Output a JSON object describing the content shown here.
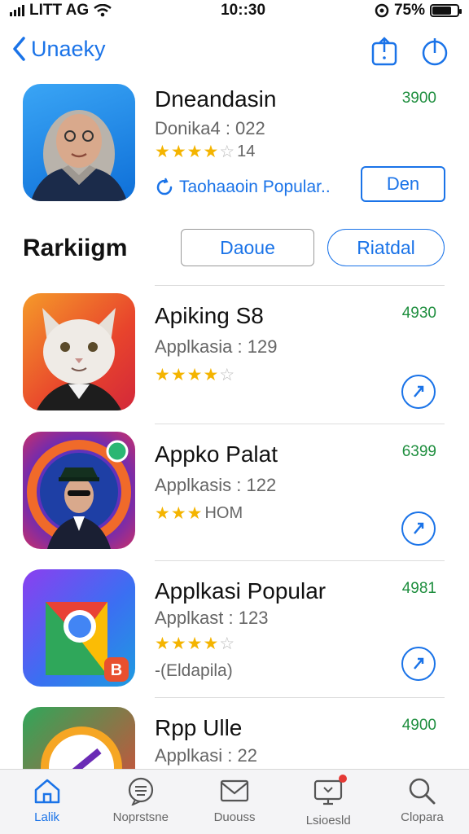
{
  "status_bar": {
    "carrier": "LITT AG",
    "time": "10::30",
    "battery": "75%",
    "battery_level": 0.75
  },
  "navbar": {
    "back_label": "Unaeky",
    "icons": [
      "share-icon",
      "power-icon"
    ]
  },
  "featured": {
    "title": "Dneandasin",
    "subtitle": "Donika4 : 022",
    "rating_stars": 4,
    "rating_extra": "14",
    "price": "3900",
    "popular_label": "Taohaaoin Popular..",
    "open_label": "Den"
  },
  "ranking": {
    "title": "Rarkiigm",
    "filters": [
      "Daoue",
      "Riatdal"
    ]
  },
  "apps": [
    {
      "title": "Apiking S8",
      "subtitle": "Applkasia : 129",
      "stars": 4,
      "extra": "",
      "price": "4930",
      "meta": ""
    },
    {
      "title": "Appko Palat",
      "subtitle": "Applkasis : 122",
      "stars": 3,
      "extra": "HOM",
      "price": "6399",
      "meta": ""
    },
    {
      "title": "Applkasi Popular",
      "subtitle": "Applkast : 123",
      "stars": 4,
      "extra": "",
      "price": "4981",
      "meta": "-(Eldapila)"
    },
    {
      "title": "Rpp Ulle",
      "subtitle": "Applkasi : 22",
      "stars": 0,
      "extra": "",
      "price": "4900",
      "meta": ""
    }
  ],
  "tabbar": [
    {
      "label": "Lalik",
      "icon": "home-icon",
      "active": true
    },
    {
      "label": "Noprstsne",
      "icon": "chat-icon",
      "active": false
    },
    {
      "label": "Duouss",
      "icon": "mail-icon",
      "active": false
    },
    {
      "label": "Lsioesld",
      "icon": "tv-icon",
      "active": false
    },
    {
      "label": "Clopara",
      "icon": "search-icon",
      "active": false
    }
  ],
  "colors": {
    "accent": "#1a73e8",
    "price": "#1e8e3e",
    "star": "#f4b400"
  }
}
